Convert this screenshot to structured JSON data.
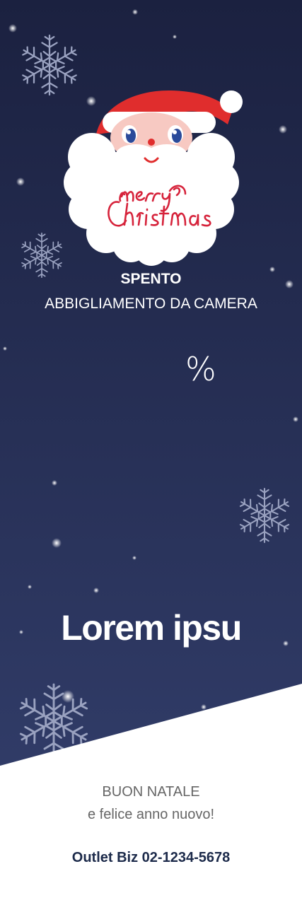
{
  "banner": {
    "title_line1": "SPENTO",
    "title_line2": "ABBIGLIAMENTO DA CAMERA",
    "discount_symbol": "%",
    "headline": "Lorem ipsu",
    "greeting_line1": "BUON NATALE",
    "greeting_line2": "e felice anno nuovo!",
    "contact": "Outlet Biz 02-1234-5678",
    "logo_text": "merry Christmas",
    "colors": {
      "sky_top": "#1b2140",
      "sky_bottom": "#34406e",
      "santa_red": "#e02d2d",
      "contact_navy": "#1c2a4a",
      "greeting_gray": "#666666"
    },
    "icons": [
      "snowflake-icon",
      "santa-claus-icon"
    ]
  }
}
